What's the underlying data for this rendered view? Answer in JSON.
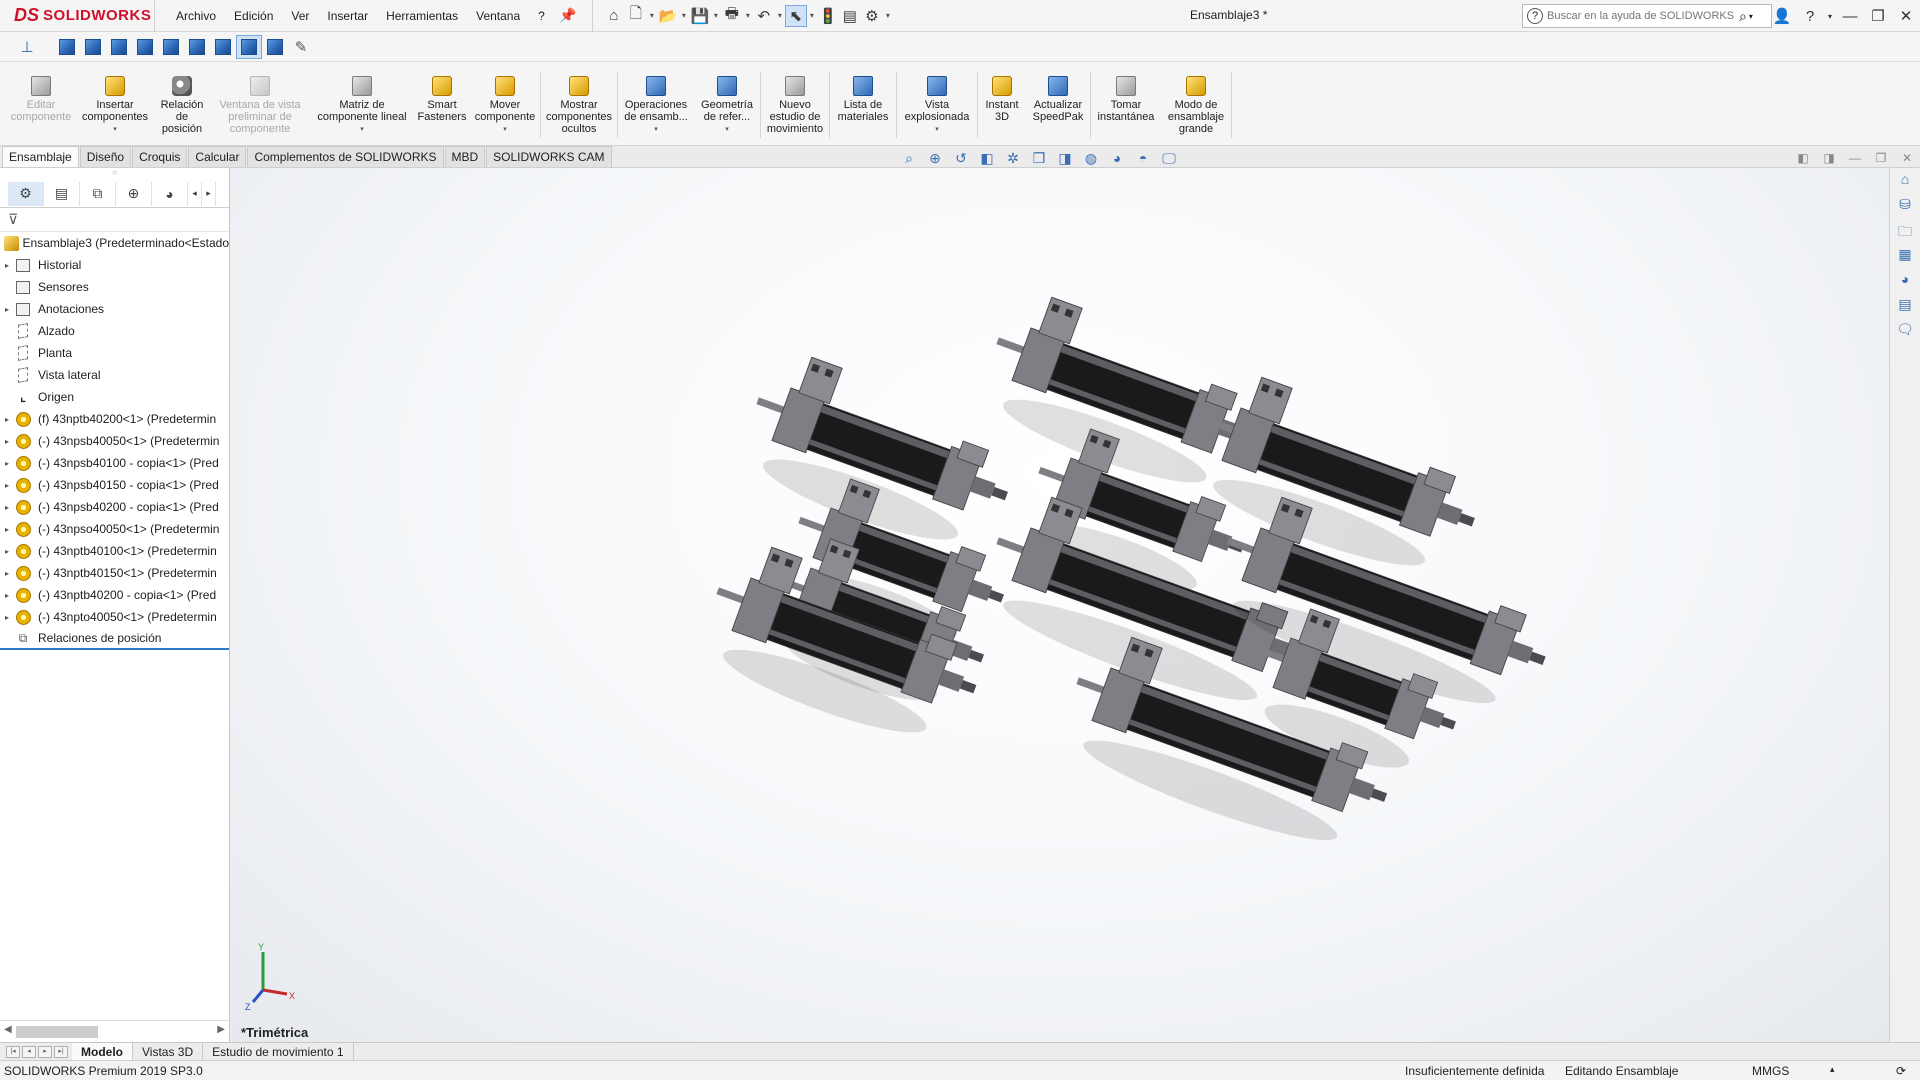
{
  "app": {
    "brand_ds": "DS",
    "brand_name": "SOLIDWORKS",
    "doc_title": "Ensamblaje3 *"
  },
  "menus": [
    "Archivo",
    "Edición",
    "Ver",
    "Insertar",
    "Herramientas",
    "Ventana",
    "?"
  ],
  "search": {
    "placeholder": "Buscar en la ayuda de SOLIDWORKS"
  },
  "ribbon": [
    {
      "label": "Editar\ncomponente",
      "disabled": true,
      "icon": "edit-component-icon"
    },
    {
      "label": "Insertar\ncomponentes",
      "disabled": false,
      "icon": "insert-components-icon",
      "dropdown": true
    },
    {
      "label": "Relación\nde\nposición",
      "disabled": false,
      "icon": "mate-icon"
    },
    {
      "label": "Ventana de vista\npreliminar de\ncomponente",
      "disabled": true,
      "icon": "preview-window-icon"
    },
    {
      "label": "Matriz de\ncomponente lineal",
      "disabled": false,
      "icon": "linear-pattern-icon",
      "dropdown": true
    },
    {
      "label": "Smart\nFasteners",
      "disabled": false,
      "icon": "smart-fasteners-icon"
    },
    {
      "label": "Mover\ncomponente",
      "disabled": false,
      "icon": "move-component-icon",
      "dropdown": true
    },
    {
      "label": "Mostrar\ncomponentes\nocultos",
      "disabled": false,
      "icon": "show-hidden-icon"
    },
    {
      "label": "Operaciones\nde ensamb...",
      "disabled": false,
      "icon": "assembly-features-icon",
      "dropdown": true
    },
    {
      "label": "Geometría\nde refer...",
      "disabled": false,
      "icon": "reference-geometry-icon",
      "dropdown": true
    },
    {
      "label": "Nuevo\nestudio de\nmovimiento",
      "disabled": false,
      "icon": "motion-study-icon"
    },
    {
      "label": "Lista de\nmateriales",
      "disabled": false,
      "icon": "bill-of-materials-icon"
    },
    {
      "label": "Vista\nexplosionada",
      "disabled": false,
      "icon": "exploded-view-icon",
      "dropdown": true
    },
    {
      "label": "Instant\n3D",
      "disabled": false,
      "icon": "instant3d-icon"
    },
    {
      "label": "Actualizar\nSpeedPak",
      "disabled": false,
      "icon": "speedpak-icon"
    },
    {
      "label": "Tomar\ninstantánea",
      "disabled": false,
      "icon": "camera-icon"
    },
    {
      "label": "Modo de\nensamblaje\ngrande",
      "disabled": false,
      "icon": "large-assembly-icon"
    }
  ],
  "command_tabs": [
    "Ensamblaje",
    "Diseño",
    "Croquis",
    "Calcular",
    "Complementos de SOLIDWORKS",
    "MBD",
    "SOLIDWORKS CAM"
  ],
  "tree": {
    "root": "Ensamblaje3  (Predeterminado<Estado",
    "items": [
      {
        "label": "Historial",
        "type": "folder",
        "expandable": true
      },
      {
        "label": "Sensores",
        "type": "folder",
        "expandable": false
      },
      {
        "label": "Anotaciones",
        "type": "folder",
        "expandable": true
      },
      {
        "label": "Alzado",
        "type": "plane",
        "expandable": false
      },
      {
        "label": "Planta",
        "type": "plane",
        "expandable": false
      },
      {
        "label": "Vista lateral",
        "type": "plane",
        "expandable": false
      },
      {
        "label": "Origen",
        "type": "origin",
        "expandable": false
      },
      {
        "label": "(f) 43nptb40200<1> (Predetermin",
        "type": "comp",
        "expandable": true
      },
      {
        "label": "(-) 43npsb40050<1> (Predetermin",
        "type": "comp",
        "expandable": true
      },
      {
        "label": "(-) 43npsb40100 - copia<1> (Pred",
        "type": "comp",
        "expandable": true
      },
      {
        "label": "(-) 43npsb40150 - copia<1> (Pred",
        "type": "comp",
        "expandable": true
      },
      {
        "label": "(-) 43npsb40200 - copia<1> (Pred",
        "type": "comp",
        "expandable": true
      },
      {
        "label": "(-) 43npso40050<1> (Predetermin",
        "type": "comp",
        "expandable": true
      },
      {
        "label": "(-) 43nptb40100<1> (Predetermin",
        "type": "comp",
        "expandable": true
      },
      {
        "label": "(-) 43nptb40150<1> (Predetermin",
        "type": "comp",
        "expandable": true
      },
      {
        "label": "(-) 43nptb40200 - copia<1> (Pred",
        "type": "comp",
        "expandable": true
      },
      {
        "label": "(-) 43npto40050<1> (Predetermin",
        "type": "comp",
        "expandable": true
      },
      {
        "label": "Relaciones de posición",
        "type": "mates",
        "expandable": false
      }
    ]
  },
  "viewport": {
    "view_name": "*Trimétrica",
    "triad": {
      "x": "X",
      "y": "Y",
      "z": "Z"
    }
  },
  "model_tabs": [
    "Modelo",
    "Vistas 3D",
    "Estudio de movimiento 1"
  ],
  "status": {
    "product": "SOLIDWORKS Premium 2019 SP3.0",
    "definition": "Insuficientemente definida",
    "mode": "Editando Ensamblaje",
    "units": "MMGS"
  },
  "colors": {
    "brand": "#d0102a",
    "accent": "#2d7bc4",
    "cylinder_dark": "#1a1a1a",
    "cylinder_grey": "#7d7f84"
  }
}
